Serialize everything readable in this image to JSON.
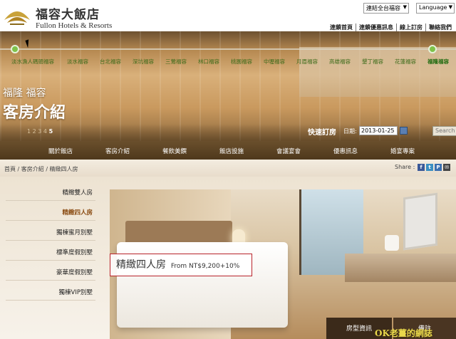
{
  "header": {
    "logo_zh": "福容大飯店",
    "logo_en": "Fullon Hotels & Resorts",
    "branch_select": "連結全台福容",
    "language_select": "Language",
    "top_links": [
      "連鎖首頁",
      "連鎖優惠訊息",
      "線上訂房",
      "聯絡我們"
    ]
  },
  "hero": {
    "branches": [
      "淡水漁人碼頭福容",
      "淡水福容",
      "台北福容",
      "深坑福容",
      "三鶯福容",
      "林口福容",
      "桃園福容",
      "中壢福容",
      "月眉福容",
      "高雄福容",
      "墾丁福容",
      "花蓮福容",
      "福隆福容"
    ],
    "active_branch_index": 12,
    "subtitle": "福隆 福容",
    "title": "客房介紹",
    "pager": [
      "1",
      "2",
      "3",
      "4",
      "5"
    ],
    "pager_active_index": 4
  },
  "booking": {
    "label": "快速訂房",
    "date_label": "日期:",
    "date_value": "2013-01-25",
    "search_placeholder": "Search"
  },
  "nav": {
    "items": [
      "關於飯店",
      "客房介紹",
      "餐飲美饌",
      "飯店設施",
      "會議宴會",
      "優惠訊息",
      "婚宴專案"
    ]
  },
  "breadcrumb": {
    "text": "首頁 / 客房介紹 / 精緻四人房"
  },
  "share": {
    "label": "Share :",
    "icons": [
      "f",
      "t",
      "P",
      "✉"
    ]
  },
  "sidebar": {
    "items": [
      "精緻雙人房",
      "精緻四人房",
      "獨棟蜜月別墅",
      "標準度假別墅",
      "豪華度假別墅",
      "獨棟VIP別墅"
    ],
    "active_index": 1
  },
  "room": {
    "name": "精緻四人房",
    "price": "From NT$9,200+10%"
  },
  "tabs": [
    "房型資訊",
    "備註"
  ],
  "watermark": "OK老薑的網誌",
  "colors": {
    "nav_bg": "#5c4324",
    "active_side": "#8a4b12",
    "caption_border": "#b9232a",
    "timeline_dot": "#7ec24a"
  }
}
